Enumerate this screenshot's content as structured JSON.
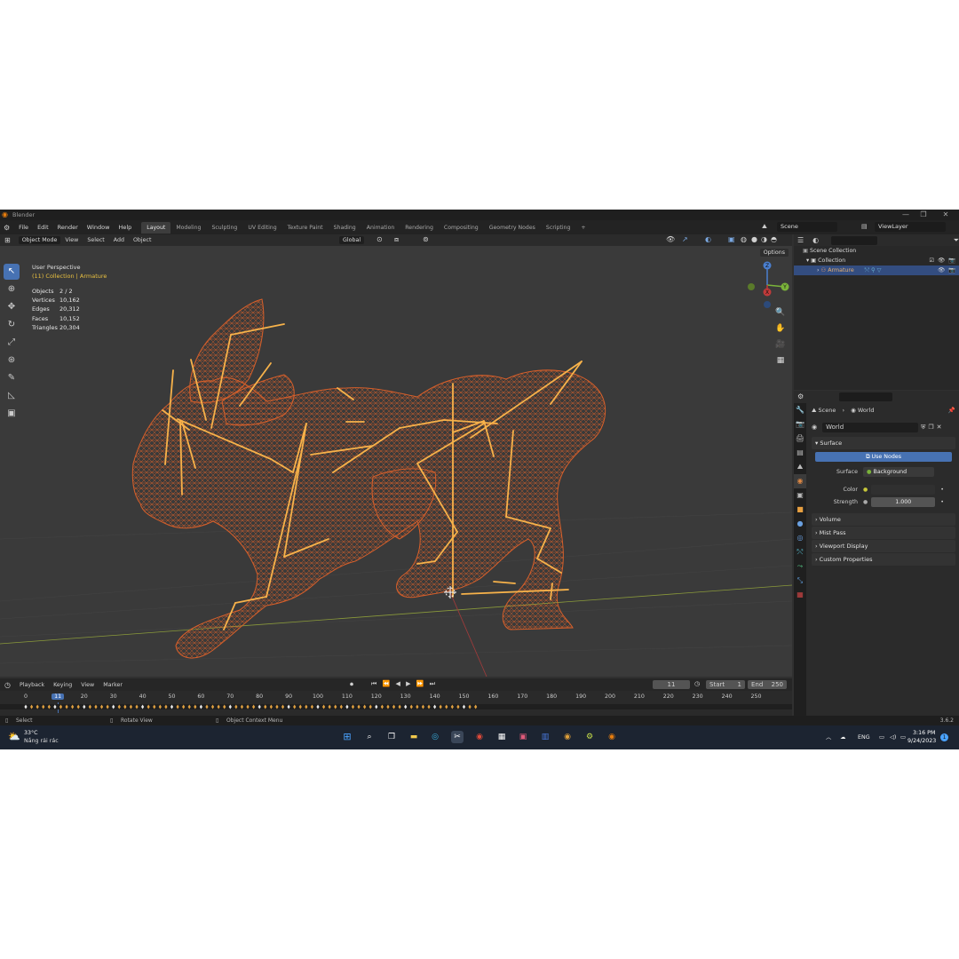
{
  "window": {
    "title": "Blender",
    "version": "3.6.2"
  },
  "menu": [
    "File",
    "Edit",
    "Render",
    "Window",
    "Help"
  ],
  "workspaces": [
    "Layout",
    "Modeling",
    "Sculpting",
    "UV Editing",
    "Texture Paint",
    "Shading",
    "Animation",
    "Rendering",
    "Compositing",
    "Geometry Nodes",
    "Scripting"
  ],
  "active_workspace": "Layout",
  "scene": "Scene",
  "view_layer": "ViewLayer",
  "viewport": {
    "mode": "Object Mode",
    "menus": [
      "View",
      "Select",
      "Add",
      "Object"
    ],
    "transform_orientation": "Global",
    "options_label": "Options",
    "perspective": "User Perspective",
    "collection_info": "(11) Collection | Armature",
    "stats": [
      {
        "label": "Objects",
        "value": "2 / 2"
      },
      {
        "label": "Vertices",
        "value": "10,162"
      },
      {
        "label": "Edges",
        "value": "20,312"
      },
      {
        "label": "Faces",
        "value": "10,152"
      },
      {
        "label": "Triangles",
        "value": "20,304"
      }
    ],
    "gizmo": {
      "z": "Z",
      "x": "X",
      "y": "Y"
    },
    "wire_color": "#e0622a",
    "bone_color": "#f7b24a"
  },
  "outliner": {
    "items": [
      {
        "label": "Scene Collection",
        "indent": 0
      },
      {
        "label": "Collection",
        "indent": 1
      },
      {
        "label": "Armature",
        "indent": 2,
        "selected": true
      }
    ]
  },
  "properties": {
    "breadcrumb": [
      "Scene",
      "World"
    ],
    "world_name": "World",
    "surface_panel": "Surface",
    "use_nodes_label": "Use Nodes",
    "surface_label": "Surface",
    "surface_value": "Background",
    "color_label": "Color",
    "strength_label": "Strength",
    "strength_value": "1.000",
    "collapsed_panels": [
      "Volume",
      "Mist Pass",
      "Viewport Display",
      "Custom Properties"
    ]
  },
  "timeline": {
    "menus": [
      "Playback",
      "Keying",
      "View",
      "Marker"
    ],
    "current_frame": "11",
    "start_label": "Start",
    "start": "1",
    "end_label": "End",
    "end": "250",
    "ticks": [
      "0",
      "10",
      "20",
      "30",
      "40",
      "50",
      "60",
      "70",
      "80",
      "90",
      "100",
      "110",
      "120",
      "130",
      "140",
      "150",
      "160",
      "170",
      "180",
      "190",
      "200",
      "210",
      "220",
      "230",
      "240",
      "250"
    ],
    "current_tick_label": "11"
  },
  "statusbar": {
    "left": "Select",
    "middle": "Rotate View",
    "right": "Object Context Menu"
  },
  "taskbar": {
    "weather_temp": "33°C",
    "weather_desc": "Nắng rải rác",
    "lang": "ENG",
    "time": "3:16 PM",
    "date": "9/24/2023",
    "notif": "1"
  }
}
